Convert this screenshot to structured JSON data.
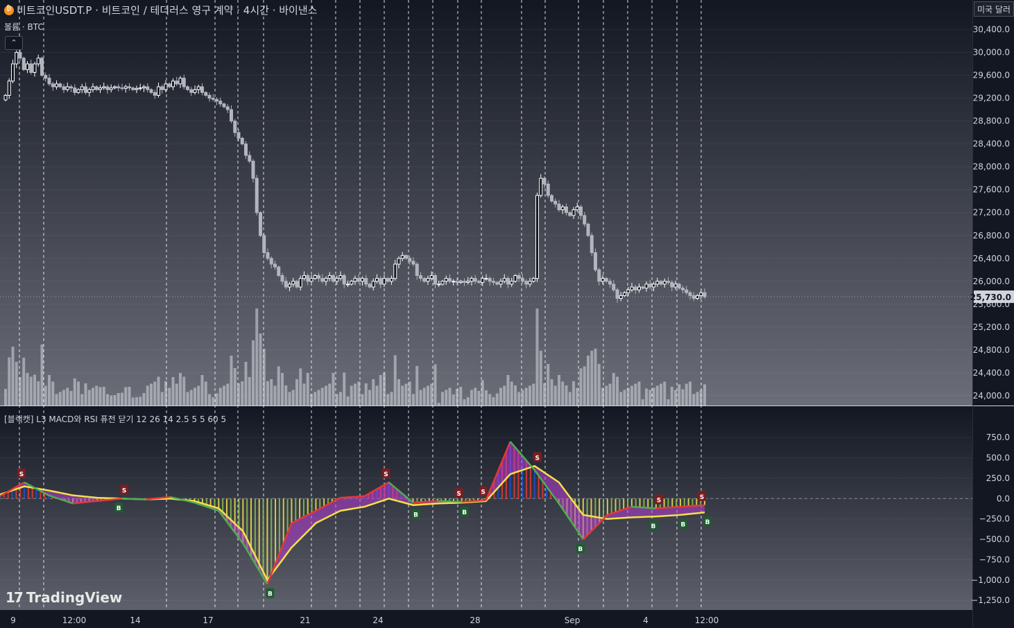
{
  "header": {
    "title": "비트코인USDT.P · 비트코인 / 테더러스 영구 계약 · 4시간 · 바이낸스",
    "volume_label": "볼륨 · BTC",
    "collapse_icon": "chevron-up-icon"
  },
  "indicator": {
    "title": "[블랙캣] L3 MACD와 RSI 퓨전 닫기 12 26 14 2.5 5 5 60 5"
  },
  "currency_button": "미국 달러",
  "branding": {
    "logo_text": "TradingView"
  },
  "colors": {
    "background": "#131722",
    "candle_up": "#ffffff",
    "candle_down": "#b2b5be",
    "macd_up": "#e53935",
    "macd_down": "#1e4fd8",
    "fast_line_up": "#e53935",
    "fast_line_down": "#4caf50",
    "signal_line": "#f5e24a",
    "signal_fill_neg": "#b83ed6",
    "sell_marker": "#7a1e22",
    "buy_marker": "#1e5c2f"
  },
  "chart_data": [
    {
      "type": "candlestick",
      "price_axis_ticks": [
        "30,400.0",
        "30,000.0",
        "29,600.0",
        "29,200.0",
        "28,800.0",
        "28,400.0",
        "28,000.0",
        "27,600.0",
        "27,200.0",
        "26,800.0",
        "26,400.0",
        "26,000.0",
        "25,600.0",
        "25,200.0",
        "24,800.0",
        "24,400.0",
        "24,000.0"
      ],
      "ylim": [
        23950,
        30480
      ],
      "last_price_label": "25,730.0",
      "last_price": 25730,
      "x_tick_labels": [
        "9",
        "12:00",
        "14",
        "17",
        "21",
        "24",
        "28",
        "Sep",
        "4",
        "12:00"
      ],
      "closes": [
        29250,
        29500,
        29800,
        30000,
        29900,
        29700,
        29800,
        29650,
        29800,
        29900,
        29600,
        29550,
        29450,
        29400,
        29450,
        29400,
        29350,
        29400,
        29380,
        29300,
        29350,
        29400,
        29300,
        29350,
        29400,
        29350,
        29380,
        29400,
        29350,
        29380,
        29400,
        29380,
        29370,
        29400,
        29380,
        29350,
        29370,
        29380,
        29400,
        29350,
        29300,
        29250,
        29400,
        29350,
        29450,
        29400,
        29500,
        29450,
        29550,
        29400,
        29350,
        29300,
        29350,
        29400,
        29300,
        29250,
        29200,
        29180,
        29150,
        29100,
        29050,
        29000,
        28800,
        28600,
        28500,
        28400,
        28200,
        28100,
        27800,
        27200,
        26800,
        26500,
        26400,
        26300,
        26250,
        26100,
        26000,
        25900,
        25950,
        26000,
        25900,
        26050,
        26100,
        26000,
        26050,
        26100,
        26050,
        26000,
        26050,
        26100,
        26000,
        26050,
        26100,
        25950,
        25950,
        26000,
        26050,
        26000,
        26050,
        25950,
        25900,
        26000,
        26050,
        25950,
        26050,
        26000,
        26050,
        26300,
        26400,
        26450,
        26400,
        26350,
        26300,
        26100,
        26050,
        26000,
        26050,
        26100,
        25950,
        25950,
        26000,
        26050,
        26000,
        26000,
        25980,
        26000,
        25980,
        26000,
        26050,
        26000,
        25980,
        26050,
        26050,
        26000,
        25980,
        25950,
        26000,
        26050,
        25950,
        26000,
        26100,
        26050,
        26000,
        25950,
        26000,
        26050,
        27500,
        27800,
        27700,
        27500,
        27400,
        27350,
        27250,
        27300,
        27200,
        27150,
        27250,
        27300,
        27150,
        27000,
        26800,
        26500,
        26200,
        26000,
        26050,
        26000,
        25950,
        25850,
        25700,
        25750,
        25800,
        25850,
        25900,
        25850,
        25900,
        25880,
        25950,
        25900,
        25950,
        26000,
        25950,
        26000,
        25980,
        25900,
        25950,
        25880,
        25850,
        25800,
        25750,
        25700,
        25750,
        25800,
        25730
      ]
    },
    {
      "type": "line",
      "title": "[블랙캣] L3 MACD와 RSI 퓨전 닫기 12 26 14 2.5 5 5 60 5",
      "ylim": [
        -1350,
        1100
      ],
      "y_ticks": [
        "750.0",
        "500.0",
        "250.0",
        "0.0",
        "−250.0",
        "−500.0",
        "−750.0",
        "−1,000.0",
        "−1,250.0"
      ],
      "x": [
        "9",
        "10",
        "11",
        "12",
        "13",
        "14",
        "15",
        "16",
        "17",
        "18",
        "19",
        "20",
        "21",
        "22",
        "23",
        "24",
        "25",
        "26",
        "27",
        "28",
        "29",
        "30",
        "31",
        "Sep",
        "2",
        "3",
        "4",
        "5",
        "6",
        "7"
      ],
      "series": [
        {
          "values": [
            30,
            200,
            40,
            -60,
            -30,
            0,
            -10,
            20,
            -50,
            -150,
            -550,
            -1050,
            -300,
            -150,
            10,
            30,
            200,
            -50,
            -30,
            -40,
            -20,
            700,
            350,
            -60,
            -500,
            -200,
            -100,
            -120,
            -100,
            -80
          ]
        },
        {
          "values": [
            50,
            150,
            100,
            40,
            10,
            0,
            -10,
            0,
            -30,
            -120,
            -400,
            -1000,
            -600,
            -300,
            -150,
            -100,
            0,
            -80,
            -60,
            -50,
            -30,
            300,
            400,
            200,
            -200,
            -250,
            -230,
            -220,
            -200,
            -170
          ]
        }
      ],
      "signals": [
        {
          "label": "S",
          "x": "10"
        },
        {
          "label": "S",
          "x": "14"
        },
        {
          "label": "B",
          "x": "14"
        },
        {
          "label": "B",
          "x": "20"
        },
        {
          "label": "S",
          "x": "25"
        },
        {
          "label": "B",
          "x": "26"
        },
        {
          "label": "S",
          "x": "28"
        },
        {
          "label": "B",
          "x": "28"
        },
        {
          "label": "S",
          "x": "29"
        },
        {
          "label": "S",
          "x": "31"
        },
        {
          "label": "B",
          "x": "2"
        },
        {
          "label": "S",
          "x": "5"
        },
        {
          "label": "B",
          "x": "5"
        },
        {
          "label": "B",
          "x": "6"
        },
        {
          "label": "S",
          "x": "7"
        },
        {
          "label": "B",
          "x": "7"
        }
      ]
    }
  ]
}
